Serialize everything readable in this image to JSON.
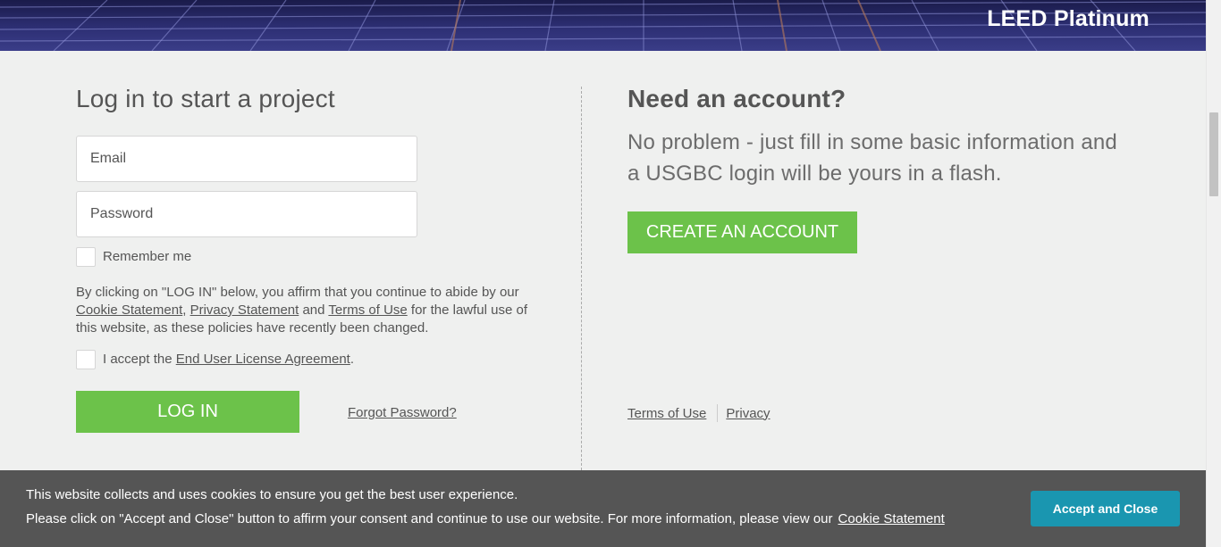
{
  "hero": {
    "title": "LEED Platinum"
  },
  "login": {
    "title": "Log in to start a project",
    "email_placeholder": "Email",
    "password_placeholder": "Password",
    "remember_label": "Remember me",
    "policy": {
      "text_before": "By clicking on \"LOG IN\" below, you affirm that you continue to abide by our ",
      "cookie_link": "Cookie Statement",
      "sep1": ", ",
      "privacy_link": "Privacy Statement",
      "sep2": " and ",
      "terms_link": "Terms of Use",
      "text_after": " for the lawful use of this website, as these policies have recently been changed."
    },
    "eula": {
      "text_before": "I accept the ",
      "link": "End User License Agreement",
      "text_after": "."
    },
    "login_button": "LOG IN",
    "forgot_link": "Forgot Password?"
  },
  "account": {
    "title": "Need an account?",
    "description": "No problem - just fill in some basic information and a USGBC login will be yours in a flash.",
    "create_button": "CREATE AN ACCOUNT"
  },
  "footer": {
    "terms": "Terms of Use",
    "privacy": "Privacy"
  },
  "cookie_banner": {
    "line1": "This website collects and uses cookies to ensure you get the best user experience.",
    "line2": "Please click on \"Accept and Close\" button to affirm your consent and continue to use our website. For more information, please view our",
    "link": "Cookie Statement",
    "accept_button": "Accept and Close"
  },
  "colors": {
    "accent_green": "#6cc24a",
    "accept_blue": "#1a96b0",
    "cookie_bg": "#555555",
    "page_bg": "#eff0ef"
  }
}
